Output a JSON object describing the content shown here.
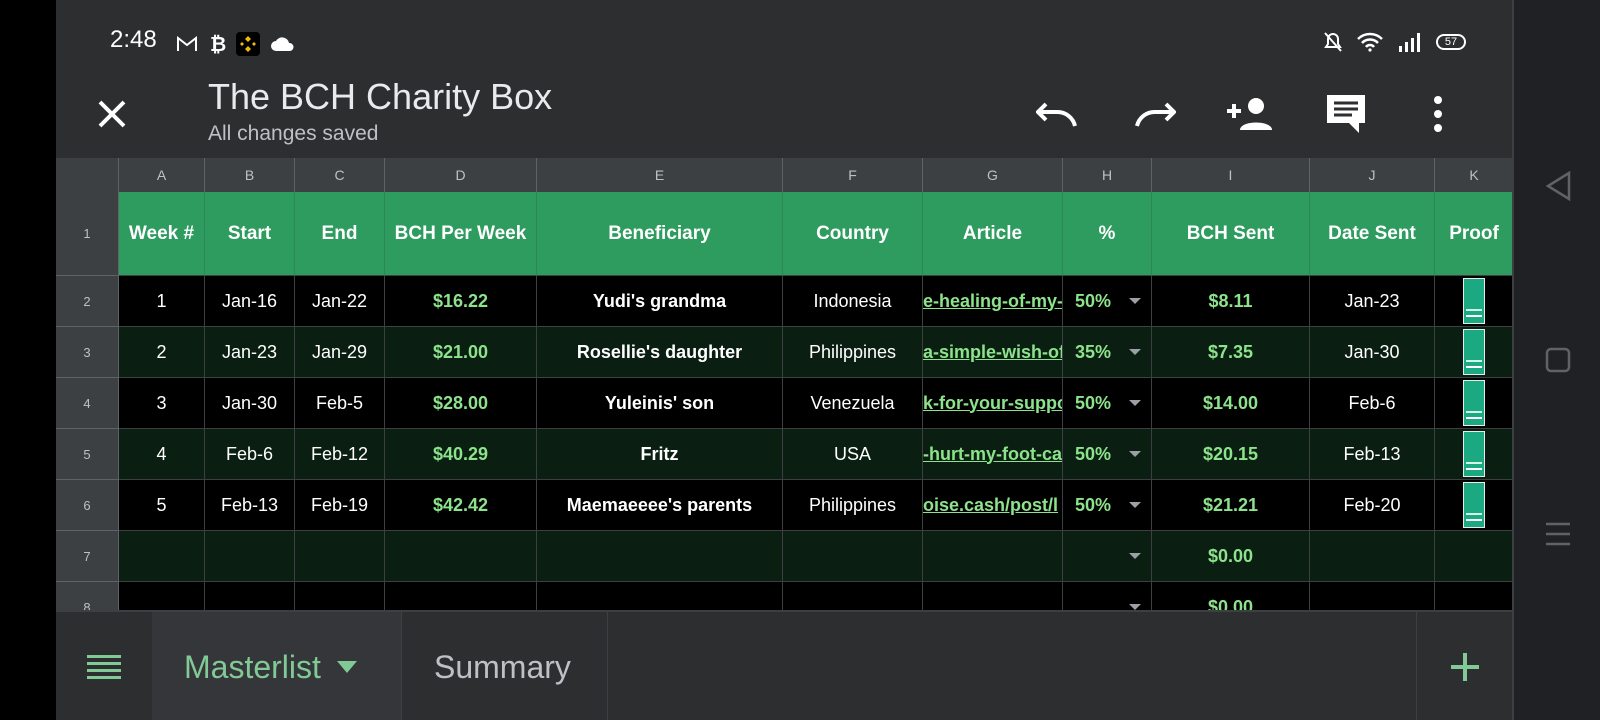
{
  "status": {
    "time": "2:48",
    "battery": "57"
  },
  "app": {
    "title": "The BCH Charity Box",
    "save_status": "All changes saved"
  },
  "columns": [
    "A",
    "B",
    "C",
    "D",
    "E",
    "F",
    "G",
    "H",
    "I",
    "J",
    "K"
  ],
  "header_row": {
    "row_number": "1",
    "week": "Week #",
    "start": "Start",
    "end": "End",
    "bch_per_week": "BCH Per Week",
    "beneficiary": "Beneficiary",
    "country": "Country",
    "article": "Article",
    "pct": "%",
    "bch_sent": "BCH Sent",
    "date_sent": "Date Sent",
    "proof": "Proof"
  },
  "rows": [
    {
      "row_number": "2",
      "week": "1",
      "start": "Jan-16",
      "end": "Jan-22",
      "bch_per_week": "$16.22",
      "beneficiary": "Yudi's grandma",
      "country": "Indonesia",
      "article": "e-healing-of-my-",
      "pct": "50%",
      "bch_sent": "$8.11",
      "date_sent": "Jan-23"
    },
    {
      "row_number": "3",
      "week": "2",
      "start": "Jan-23",
      "end": "Jan-29",
      "bch_per_week": "$21.00",
      "beneficiary": "Rosellie's daughter",
      "country": "Philippines",
      "article": "a-simple-wish-of",
      "pct": "35%",
      "bch_sent": "$7.35",
      "date_sent": "Jan-30"
    },
    {
      "row_number": "4",
      "week": "3",
      "start": "Jan-30",
      "end": "Feb-5",
      "bch_per_week": "$28.00",
      "beneficiary": "Yuleinis' son",
      "country": "Venezuela",
      "article": "k-for-your-suppo",
      "pct": "50%",
      "bch_sent": "$14.00",
      "date_sent": "Feb-6"
    },
    {
      "row_number": "5",
      "week": "4",
      "start": "Feb-6",
      "end": "Feb-12",
      "bch_per_week": "$40.29",
      "beneficiary": "Fritz",
      "country": "USA",
      "article": "-hurt-my-foot-ca",
      "pct": "50%",
      "bch_sent": "$20.15",
      "date_sent": "Feb-13"
    },
    {
      "row_number": "6",
      "week": "5",
      "start": "Feb-13",
      "end": "Feb-19",
      "bch_per_week": "$42.42",
      "beneficiary": "Maemaeeee's parents",
      "country": "Philippines",
      "article": "oise.cash/post/l",
      "pct": "50%",
      "bch_sent": "$21.21",
      "date_sent": "Feb-20"
    },
    {
      "row_number": "7",
      "bch_sent": "$0.00"
    },
    {
      "row_number": "8",
      "bch_sent": "$0.00"
    }
  ],
  "tabs": {
    "active": "Masterlist",
    "other": "Summary"
  },
  "colors": {
    "header_green": "#2e9b5f",
    "value_green": "#8de38b",
    "active_tab": "#81c995"
  }
}
